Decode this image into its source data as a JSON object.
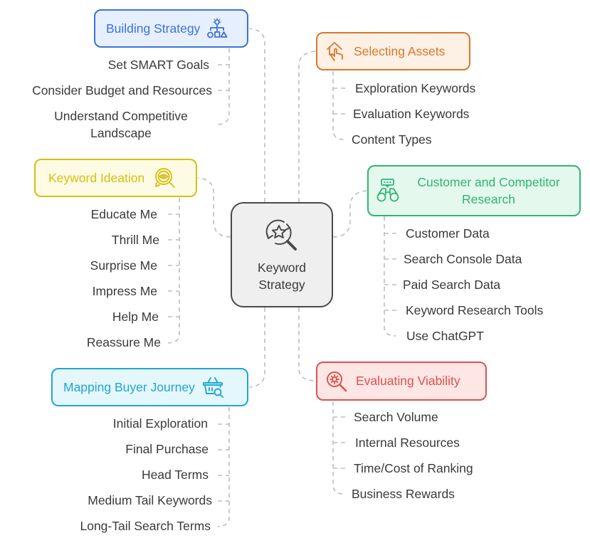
{
  "central": {
    "title_line1": "Keyword",
    "title_line2": "Strategy",
    "icon": "search-star-refresh-icon"
  },
  "branches": {
    "building_strategy": {
      "title": "Building Strategy",
      "icon": "hierarchy-lightbulb-icon",
      "color": "#3b73d6",
      "fill": "#e6effd",
      "items": [
        "Set SMART Goals",
        "Consider Budget and Resources",
        "Understand Competitive",
        "Landscape"
      ]
    },
    "selecting_assets": {
      "title": "Selecting Assets",
      "icon": "house-hand-icon",
      "color": "#d9782a",
      "fill": "#fdf0e4",
      "items": [
        "Exploration Keywords",
        "Evaluation Keywords",
        "Content Types"
      ]
    },
    "keyword_ideation": {
      "title": "Keyword Ideation",
      "icon": "eye-magnifier-icon",
      "color": "#d6bf14",
      "fill": "#fdfbe3",
      "items": [
        "Educate Me",
        "Thrill Me",
        "Surprise Me",
        "Impress Me",
        "Help Me",
        "Reassure Me"
      ]
    },
    "customer_competitor_research": {
      "title_line1": "Customer and Competitor",
      "title_line2": "Research",
      "icon": "binoculars-icon",
      "color": "#2fb574",
      "fill": "#e5f8ee",
      "items": [
        "Customer Data",
        "Search Console Data",
        "Paid Search Data",
        "Keyword Research Tools",
        "Use ChatGPT"
      ]
    },
    "mapping_buyer_journey": {
      "title": "Mapping Buyer Journey",
      "icon": "basket-search-icon",
      "color": "#1fa6cf",
      "fill": "#e4f7fd",
      "items": [
        "Initial Exploration",
        "Final Purchase",
        "Head Terms",
        "Medium Tail Keywords",
        "Long-Tail Search Terms"
      ]
    },
    "evaluating_viability": {
      "title": "Evaluating Viability",
      "icon": "gear-magnifier-icon",
      "color": "#d9534f",
      "fill": "#fde6e4",
      "items": [
        "Search Volume",
        "Internal Resources",
        "Time/Cost of Ranking",
        "Business Rewards"
      ]
    }
  }
}
